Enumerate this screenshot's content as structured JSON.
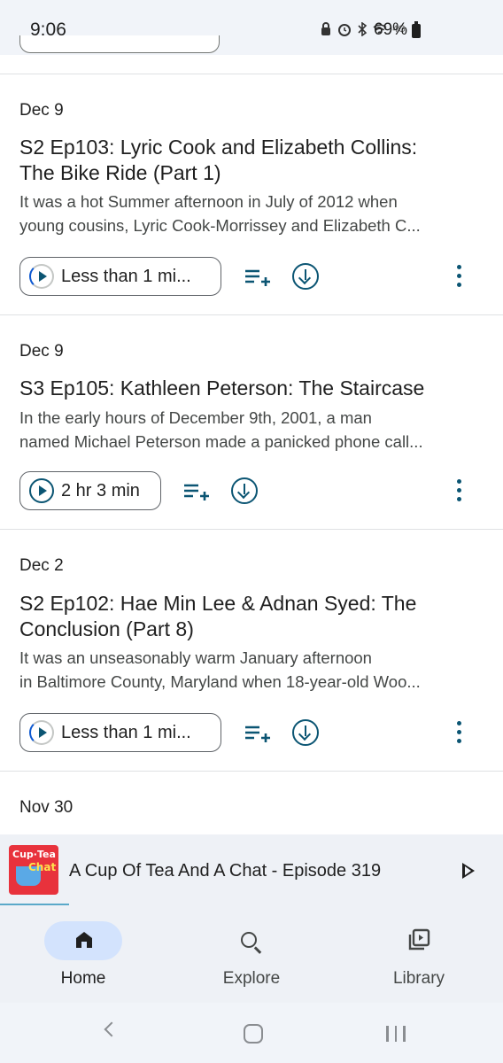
{
  "status_bar": {
    "time": "9:06",
    "network": "4G",
    "battery_percent": "69%"
  },
  "episodes": [
    {
      "date": "Dec 9",
      "title_line1": "S2 Ep103: Lyric Cook and Elizabeth Collins:",
      "title_line2": "The Bike Ride (Part 1)",
      "desc_line1": "It was a hot Summer afternoon in July of 2012 when",
      "desc_line2": "young cousins, Lyric Cook-Morrissey and Elizabeth C...",
      "duration": "Less than 1 mi..."
    },
    {
      "date": "Dec 9",
      "title_line1": "S3 Ep105: Kathleen Peterson: The Staircase",
      "title_line2": "",
      "desc_line1": "In the early hours of December 9th, 2001, a man",
      "desc_line2": "named Michael Peterson made a panicked phone call...",
      "duration": "2 hr 3 min"
    },
    {
      "date": "Dec 2",
      "title_line1": "S2 Ep102: Hae Min Lee & Adnan Syed: The",
      "title_line2": "Conclusion (Part 8)",
      "desc_line1": "It was an unseasonably warm January afternoon",
      "desc_line2": "in Baltimore County, Maryland when 18-year-old Woo...",
      "duration": "Less than 1 mi..."
    },
    {
      "date": "Nov 30"
    }
  ],
  "mini_player": {
    "title": "A Cup Of Tea And A Chat - Episode 319",
    "art_text_1": "Cup·Tea",
    "art_text_2": "Chat"
  },
  "bottom_nav": {
    "home": "Home",
    "explore": "Explore",
    "library": "Library"
  },
  "colors": {
    "accent": "#0b5573",
    "nav_pill": "#d3e3fd",
    "chrome_bg": "#eef1f6"
  }
}
